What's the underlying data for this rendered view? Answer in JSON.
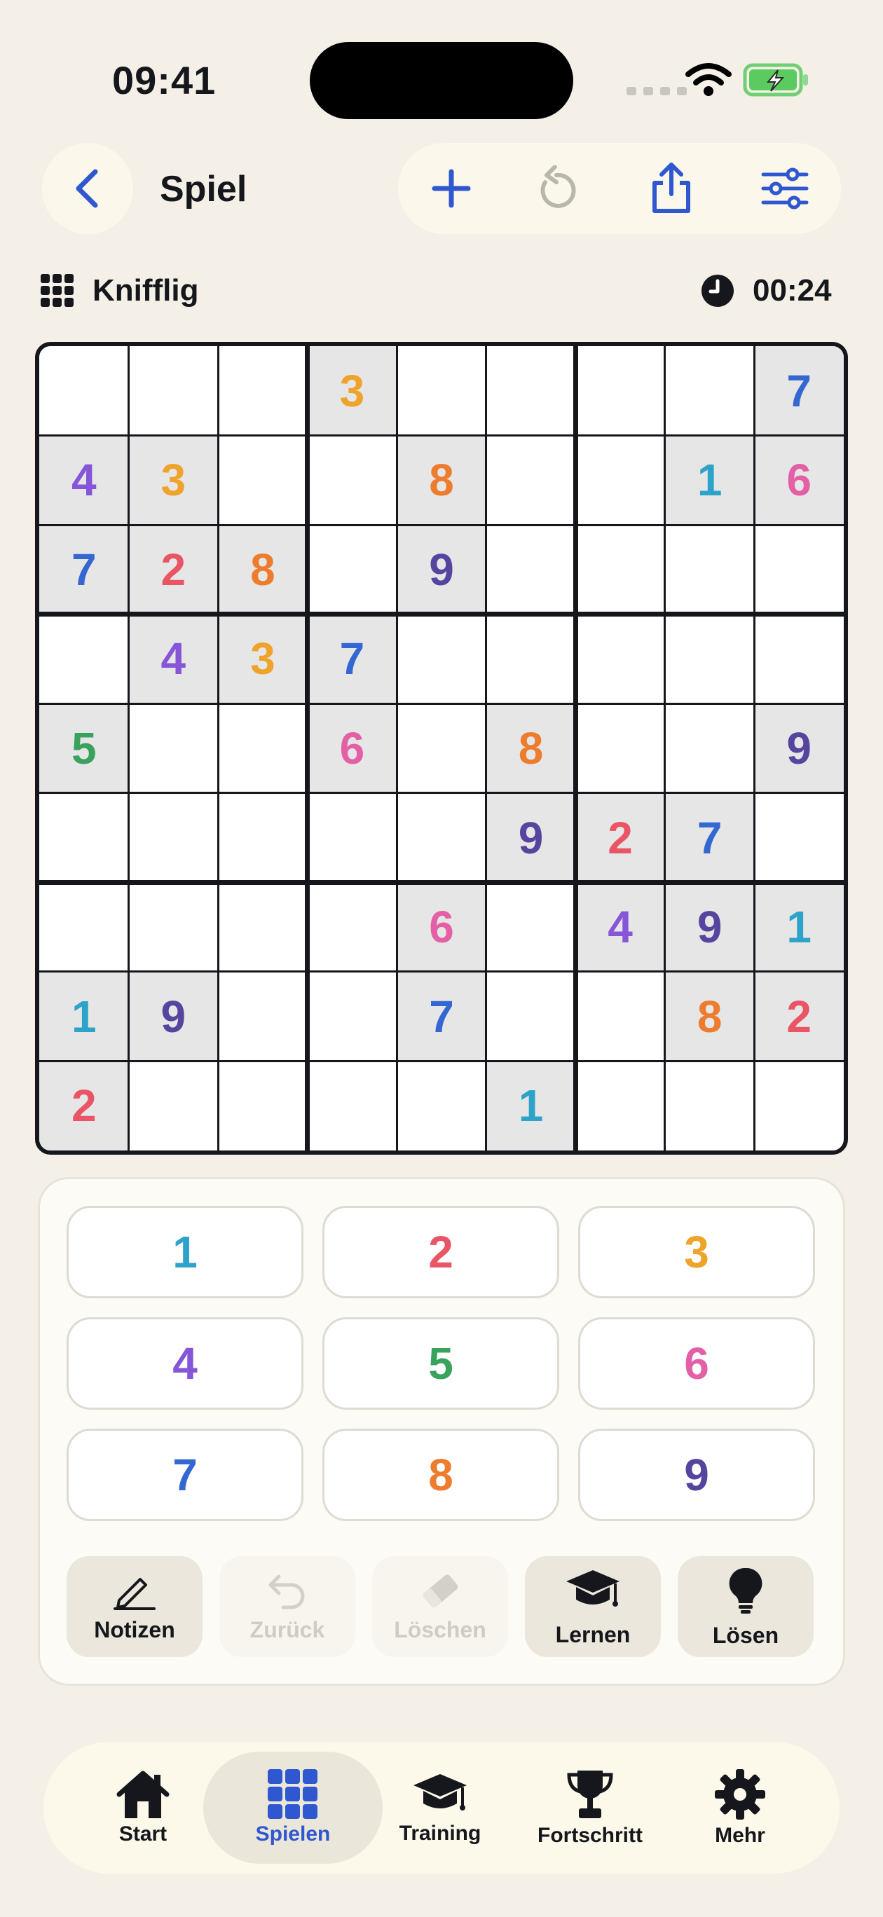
{
  "status": {
    "time": "09:41"
  },
  "header": {
    "title": "Spiel"
  },
  "info": {
    "level": "Knifflig",
    "timer": "00:24"
  },
  "colors": {
    "1": "#2ea3c9",
    "2": "#e95564",
    "3": "#eea32a",
    "4": "#8656d8",
    "5": "#39a35e",
    "6": "#e460a6",
    "7": "#3567d2",
    "8": "#ee7c2f",
    "9": "#56449e",
    "accent": "#2f57d0",
    "given_bg": "#e6e6e6"
  },
  "grid": [
    [
      "",
      "",
      "",
      "3",
      "",
      "",
      "",
      "",
      "7"
    ],
    [
      "4",
      "3",
      "",
      "",
      "8",
      "",
      "",
      "1",
      "6"
    ],
    [
      "7",
      "2",
      "8",
      "",
      "9",
      "",
      "",
      "",
      ""
    ],
    [
      "",
      "4",
      "3",
      "7",
      "",
      "",
      "",
      "",
      ""
    ],
    [
      "5",
      "",
      "",
      "6",
      "",
      "8",
      "",
      "",
      "9"
    ],
    [
      "",
      "",
      "",
      "",
      "",
      "9",
      "2",
      "7",
      ""
    ],
    [
      "",
      "",
      "",
      "",
      "6",
      "",
      "4",
      "9",
      "1"
    ],
    [
      "1",
      "9",
      "",
      "",
      "7",
      "",
      "",
      "8",
      "2"
    ],
    [
      "2",
      "",
      "",
      "",
      "",
      "1",
      "",
      "",
      ""
    ]
  ],
  "numpad": [
    "1",
    "2",
    "3",
    "4",
    "5",
    "6",
    "7",
    "8",
    "9"
  ],
  "tools": [
    {
      "label": "Notizen",
      "icon": "pencil-icon",
      "state": "active"
    },
    {
      "label": "Zurück",
      "icon": "undo-icon",
      "state": "disabled"
    },
    {
      "label": "Löschen",
      "icon": "eraser-icon",
      "state": "disabled"
    },
    {
      "label": "Lernen",
      "icon": "graduation-cap-icon",
      "state": "active"
    },
    {
      "label": "Lösen",
      "icon": "lightbulb-icon",
      "state": "active"
    }
  ],
  "tabs": [
    {
      "label": "Start",
      "icon": "house-icon",
      "selected": false
    },
    {
      "label": "Spielen",
      "icon": "grid-icon",
      "selected": true
    },
    {
      "label": "Training",
      "icon": "graduation-cap-icon",
      "selected": false
    },
    {
      "label": "Fortschritt",
      "icon": "trophy-icon",
      "selected": false
    },
    {
      "label": "Mehr",
      "icon": "gear-icon",
      "selected": false
    }
  ]
}
